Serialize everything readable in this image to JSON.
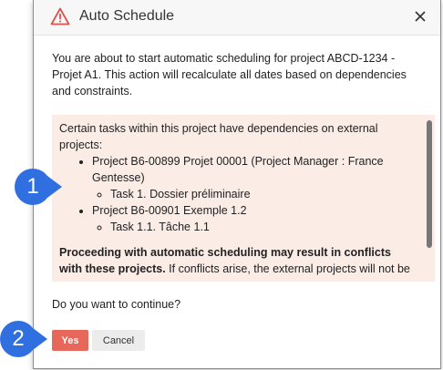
{
  "dialog": {
    "title": "Auto Schedule",
    "intro": "You are about to start automatic scheduling for project ABCD-1234 - Projet A1. This action will recalculate all dates based on dependencies and constraints.",
    "notice": {
      "heading": "Certain tasks within this project have dependencies on external projects:",
      "projects": [
        {
          "label": "Project B6-00899 Projet 00001 (Project Manager : France Gentesse)",
          "tasks": [
            "Task 1. Dossier préliminaire"
          ]
        },
        {
          "label": "Project B6-00901 Exemple 1.2",
          "tasks": [
            "Task 1.1. Tâche 1.1"
          ]
        }
      ],
      "warning_bold": "Proceeding with automatic scheduling may result in conflicts with these projects.",
      "warning_rest": " If conflicts arise, the external projects will not be"
    },
    "question": "Do you want to continue?",
    "yes_label": "Yes",
    "cancel_label": "Cancel"
  },
  "callouts": {
    "one": "1",
    "two": "2"
  },
  "icons": {
    "warning": "warning-triangle-icon",
    "close": "close-icon"
  },
  "colors": {
    "accent_yes": "#e8675b",
    "notice_bg": "#fbece6",
    "callout": "#2f6fe0",
    "warning_icon": "#d9534f"
  }
}
